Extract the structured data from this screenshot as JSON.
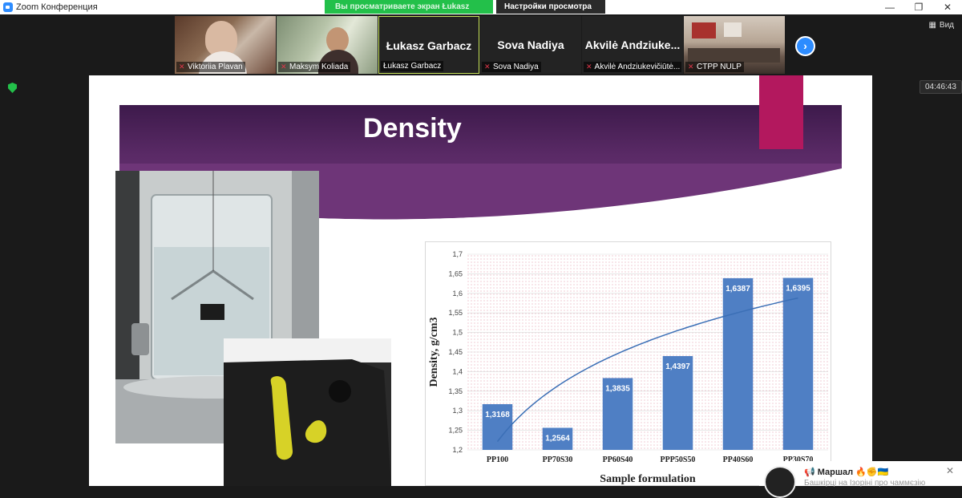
{
  "window": {
    "title": "Zoom Конференция",
    "controls": [
      "—",
      "❐",
      "✕"
    ]
  },
  "share_banner": {
    "viewing": "Вы просматриваете экран Łukasz Garbacz",
    "settings": "Настройки просмотра ⌄"
  },
  "participants": [
    {
      "name": "Viktoriia Plavan",
      "big": ""
    },
    {
      "name": "Maksym Koliada",
      "big": ""
    },
    {
      "name": "Łukasz Garbacz",
      "big": "Łukasz Garbacz"
    },
    {
      "name": "Sova Nadiya",
      "big": "Sova Nadiya"
    },
    {
      "name": "Akvilė Andziukevičiūtė...",
      "big": "Akvilė  Andziuke..."
    },
    {
      "name": "CTPP NULP",
      "big": ""
    }
  ],
  "view_button": "Вид",
  "timer": "04:46:43",
  "slide": {
    "title": "Density"
  },
  "chart_data": {
    "type": "bar",
    "categories": [
      "PP100",
      "PP70S30",
      "PP60S40",
      "PPP50S50",
      "PP40S60",
      "PP30S70"
    ],
    "values": [
      1.3168,
      1.2564,
      1.3835,
      1.4397,
      1.6387,
      1.6395
    ],
    "value_labels": [
      "1,3168",
      "1,2564",
      "1,3835",
      "1,4397",
      "1,6387",
      "1,6395"
    ],
    "xlabel": "Sample formulation",
    "ylabel": "Density, g/cm3",
    "ylim": [
      1.2,
      1.7
    ],
    "yticks": [
      "1,2",
      "1,25",
      "1,3",
      "1,35",
      "1,4",
      "1,45",
      "1,5",
      "1,55",
      "1,6",
      "1,65",
      "1,7"
    ],
    "trendline": "logarithmic",
    "bar_color": "#4f7fc4",
    "grid": true
  },
  "chat": {
    "sender": "📢 Маршал 🔥✊🇺🇦",
    "preview": "Башкірці на Ізоріні про чаммєзію"
  }
}
